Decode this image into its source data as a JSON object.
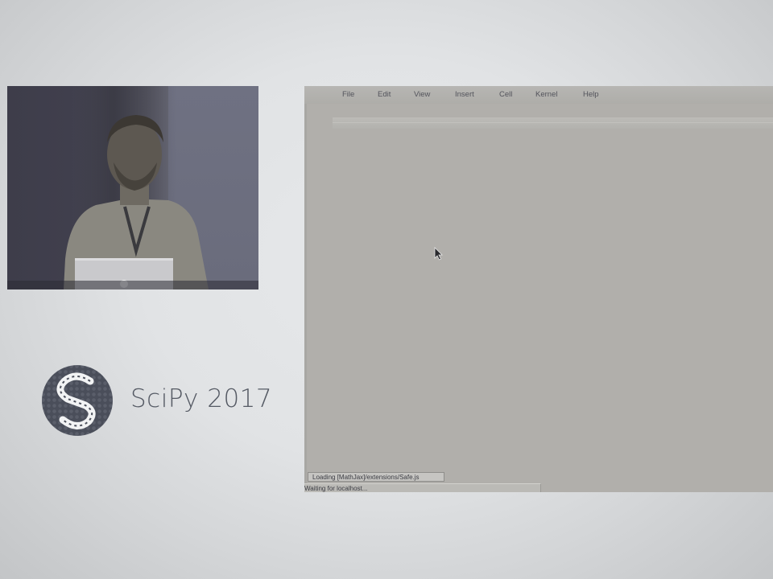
{
  "conference": {
    "logo_icon": "scipy-logo",
    "name": "SciPy 2017"
  },
  "video": {
    "subject": "speaker-video"
  },
  "notebook": {
    "menu": [
      "File",
      "Edit",
      "View",
      "Insert",
      "Cell",
      "Kernel",
      "Help"
    ],
    "loading_message": "Loading [MathJax]/extensions/Safe.js",
    "status_message": "Waiting for localhost..."
  },
  "colors": {
    "background": "#e1e3e5",
    "screen": "#b1afab",
    "logo_dark": "#4a4e5a",
    "text": "#555a64"
  }
}
